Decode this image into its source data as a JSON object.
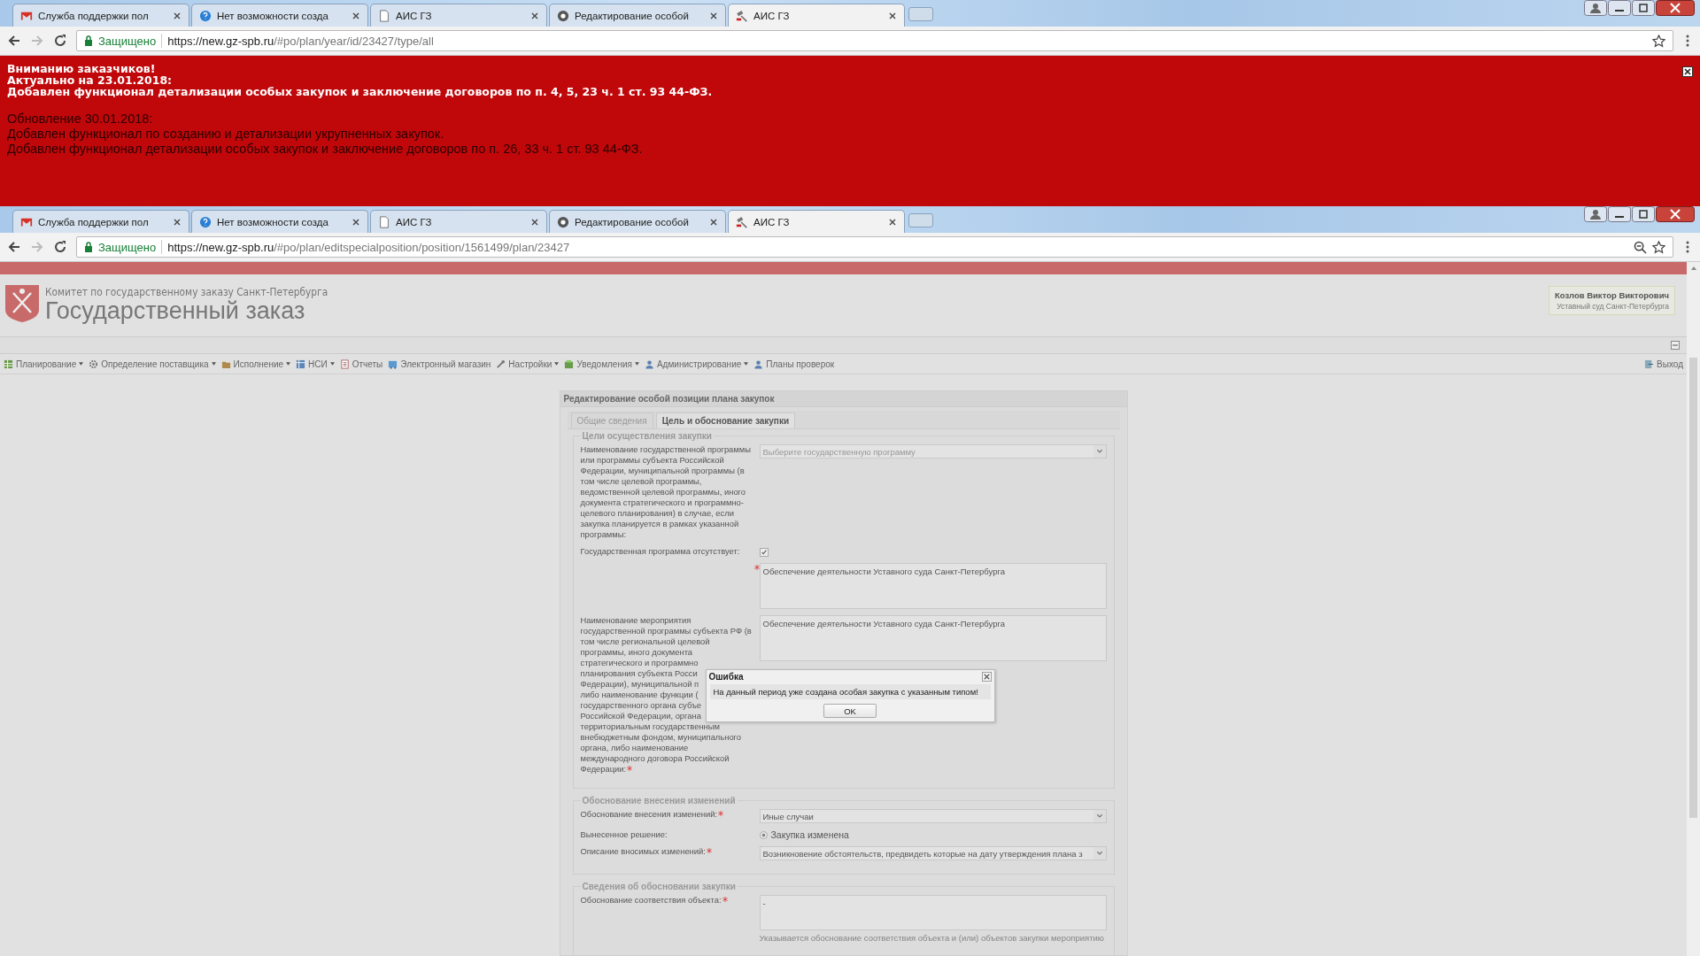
{
  "back_browser": {
    "tabs": [
      {
        "title": "Служба поддержки пол",
        "selected": false
      },
      {
        "title": "Нет возможности созда",
        "selected": false
      },
      {
        "title": "АИС ГЗ",
        "selected": false
      },
      {
        "title": "Редактирование особой",
        "selected": false
      },
      {
        "title": "АИС ГЗ",
        "selected": true
      }
    ],
    "security_label": "Защищено",
    "url_host": "https://new.gz-spb.ru",
    "url_path": "/#po/plan/year/id/23427/type/all"
  },
  "notice_banner": {
    "heading_lines": [
      "Вниманию заказчиков!",
      "Актуально на 23.01.2018:",
      "Добавлен функционал детализации особых закупок и заключение договоров по п. 4, 5, 23 ч. 1 ст. 93 44-ФЗ."
    ],
    "update_lines": [
      "Обновление 30.01.2018:",
      "Добавлен функционал по созданию и детализации укрупненных закупок.",
      "Добавлен функционал детализации особых закупок и заключение договоров по п. 26, 33 ч. 1 ст. 93 44-ФЗ."
    ]
  },
  "front_browser": {
    "tabs": [
      {
        "title": "Служба поддержки пол",
        "selected": false
      },
      {
        "title": "Нет возможности созда",
        "selected": false
      },
      {
        "title": "АИС ГЗ",
        "selected": false
      },
      {
        "title": "Редактирование особой",
        "selected": false
      },
      {
        "title": "АИС ГЗ",
        "selected": true
      }
    ],
    "security_label": "Защищено",
    "url_host": "https://new.gz-spb.ru",
    "url_path": "/#po/plan/editspecialposition/position/1561499/plan/23427"
  },
  "site_header": {
    "org": "Комитет по государственному заказу Санкт-Петербурга",
    "title": "Государственный заказ",
    "user_name": "Козлов Виктор Викторович",
    "user_org": "Уставный суд Санкт-Петербурга"
  },
  "menu": [
    {
      "label": "Планирование",
      "dropdown": true
    },
    {
      "label": "Определение поставщика",
      "dropdown": true
    },
    {
      "label": "Исполнение",
      "dropdown": true
    },
    {
      "label": "НСИ",
      "dropdown": true
    },
    {
      "label": "Отчеты",
      "dropdown": false
    },
    {
      "label": "Электронный магазин",
      "dropdown": false
    },
    {
      "label": "Настройки",
      "dropdown": true
    },
    {
      "label": "Уведомления",
      "dropdown": true
    },
    {
      "label": "Администрирование",
      "dropdown": true
    },
    {
      "label": "Планы проверок",
      "dropdown": false
    }
  ],
  "logout": "Выход",
  "form": {
    "title": "Редактирование особой позиции плана закупок",
    "tabs": [
      {
        "label": "Общие сведения",
        "selected": false
      },
      {
        "label": "Цель и обоснование закупки",
        "selected": true
      }
    ],
    "sections": [
      {
        "legend": "Цели осуществления закупки",
        "rows": [
          {
            "kind": "select",
            "label": "Наименование государственной программы или программы субъекта Российской Федерации, муниципальной программы (в том числе целевой программы, ведомственной целевой программы, иного документа стратегического и программно-целевого планирования) в случае, если закупка планируется в рамках указанной программы:",
            "placeholder": "Выберите государственную программу"
          },
          {
            "kind": "checkbox",
            "label": "Государственная программа отсутствует:",
            "checked": true
          },
          {
            "kind": "textarea",
            "required": true,
            "value": "Обеспечение деятельности Уставного суда Санкт-Петербурга"
          },
          {
            "kind": "textarea",
            "required": true,
            "label_lines": [
              "Наименование мероприятия",
              "государственной программы субъекта РФ (в",
              "том числе региональной целевой",
              "программы, иного документа",
              "стратегического и программно",
              "планирования субъекта Росси",
              "Федерации), муниципальной п",
              "либо наименование функции (",
              "государственного органа субъе",
              "Российской Федерации, органа",
              "территориальным государственным",
              "внебюджетным фондом, муниципального",
              "органа, либо наименование",
              "международного договора Российской",
              "Федерации:"
            ],
            "value": "Обеспечение деятельности Уставного суда Санкт-Петербурга"
          }
        ]
      },
      {
        "legend": "Обоснование внесения изменений",
        "rows": [
          {
            "kind": "select",
            "label": "Обоснование внесения изменений:",
            "required": true,
            "value": "Иные случаи"
          },
          {
            "kind": "radio",
            "label": "Вынесенное решение:",
            "option": "Закупка изменена",
            "selected": true
          },
          {
            "kind": "select",
            "label": "Описание вносимых изменений:",
            "required": true,
            "value": "Возникновение обстоятельств, предвидеть которые на дату утверждения плана з"
          }
        ]
      },
      {
        "legend": "Сведения об обосновании закупки",
        "rows": [
          {
            "kind": "textarea",
            "label": "Обоснование соответствия объекта:",
            "required": true,
            "value": "-",
            "hint": "Указывается обоснование соответствия объекта и (или) объектов закупки мероприятию"
          }
        ]
      }
    ]
  },
  "error_dialog": {
    "title": "Ошибка",
    "message": "На данный период уже создана особая закупка с указанным типом!",
    "ok": "OK"
  }
}
